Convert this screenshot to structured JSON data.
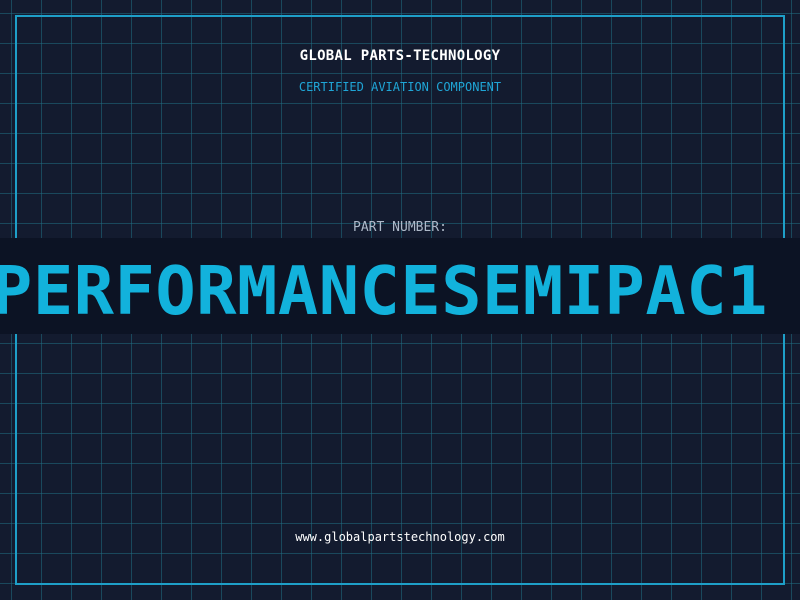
{
  "header": {
    "company": "GLOBAL PARTS-TECHNOLOGY",
    "subtitle": "CERTIFIED AVIATION COMPONENT"
  },
  "part": {
    "label": "PART NUMBER:",
    "number": "PERFORMANCESEMIPAC1"
  },
  "footer": {
    "website": "www.globalpartstechnology.com"
  },
  "colors": {
    "background": "#131b2f",
    "grid": "#1e6e82",
    "frame": "#1e9fc8",
    "accent": "#12b2dc",
    "band": "#0c1324"
  }
}
